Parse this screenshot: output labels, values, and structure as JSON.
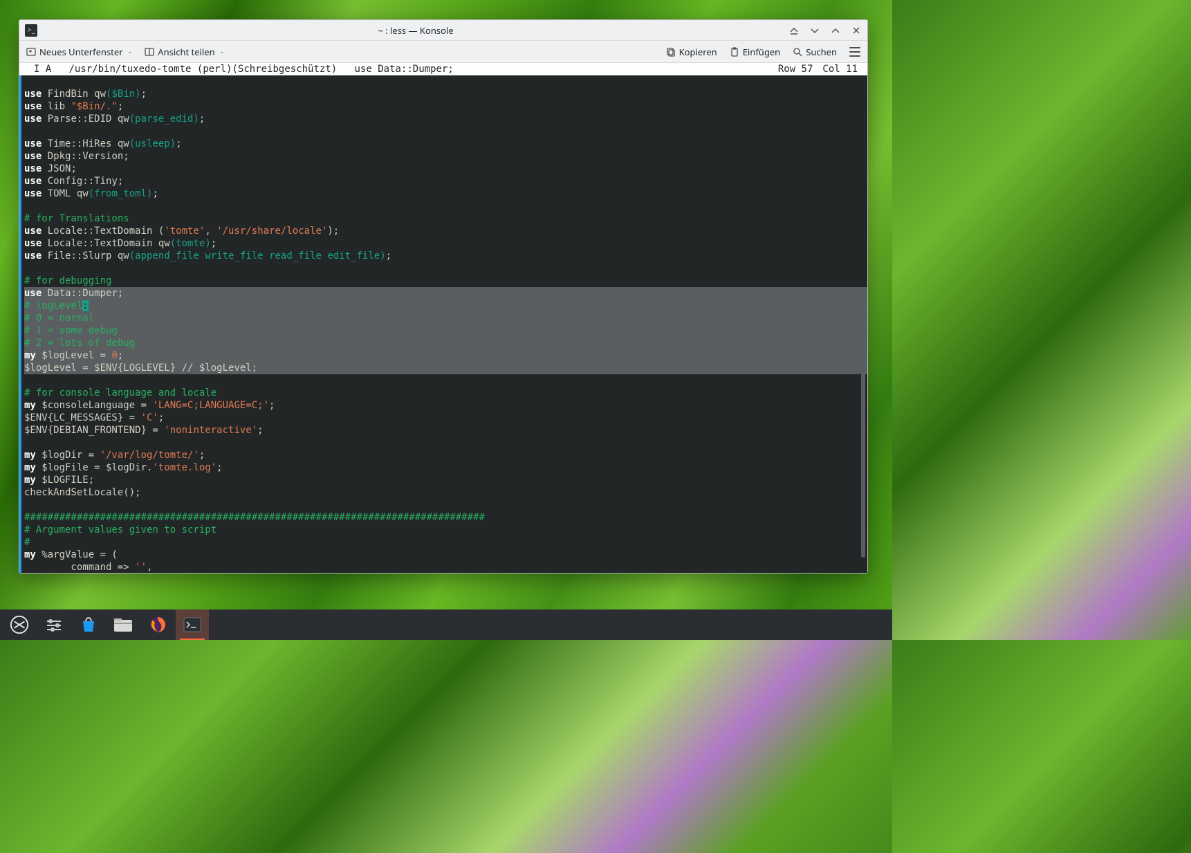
{
  "window": {
    "title": "~ : less — Konsole"
  },
  "toolbar": {
    "new_subwindow": "Neues Unterfenster",
    "split_view": "Ansicht teilen",
    "copy": "Kopieren",
    "paste": "Einfügen",
    "search": "Suchen"
  },
  "status": {
    "mode": "  I A",
    "path": "/usr/bin/tuxedo-tomte",
    "lang": "(perl)",
    "readonly": "(Schreibgeschützt)",
    "decl": "use Data::Dumper;",
    "row_label": "Row",
    "row_val": "57",
    "col_label": "Col",
    "col_val": "11"
  },
  "code": {
    "l01_a": "use",
    "l01_b": " FindBin qw",
    "l01_c": "(",
    "l01_d": "$Bin",
    "l01_e": ")",
    "l01_f": ";",
    "l02_a": "use",
    "l02_b": " lib ",
    "l02_c": "\"$Bin/.\"",
    "l02_d": ";",
    "l03_a": "use",
    "l03_b": " Parse::EDID qw",
    "l03_c": "(",
    "l03_d": "parse_edid",
    "l03_e": ")",
    "l03_f": ";",
    "l05_a": "use",
    "l05_b": " Time::HiRes qw",
    "l05_c": "(",
    "l05_d": "usleep",
    "l05_e": ")",
    "l05_f": ";",
    "l06_a": "use",
    "l06_b": " Dpkg::Version;",
    "l07_a": "use",
    "l07_b": " JSON;",
    "l08_a": "use",
    "l08_b": " Config::Tiny;",
    "l09_a": "use",
    "l09_b": " TOML qw",
    "l09_c": "(",
    "l09_d": "from_toml",
    "l09_e": ")",
    "l09_f": ";",
    "l11": "# for Translations",
    "l12_a": "use",
    "l12_b": " Locale::TextDomain (",
    "l12_c": "'tomte'",
    "l12_d": ", ",
    "l12_e": "'/usr/share/locale'",
    "l12_f": ");",
    "l13_a": "use",
    "l13_b": " Locale::TextDomain qw",
    "l13_c": "(",
    "l13_d": "tomte",
    "l13_e": ")",
    "l13_f": ";",
    "l14_a": "use",
    "l14_b": " File::Slurp qw",
    "l14_c": "(",
    "l14_d": "append_file write_file read_file edit_file",
    "l14_e": ")",
    "l14_f": ";",
    "l16": "# for debugging",
    "l17_a": "use",
    "l17_b": " Data::Dumper;",
    "l18_a": "# logLevel",
    "l18_b": ":",
    "l19": "# 0 = normal",
    "l20": "# 1 = some debug",
    "l21": "# 2 = lots of debug",
    "l22_a": "my",
    "l22_b": " $logLevel = ",
    "l22_c": "0",
    "l22_d": ";",
    "l23": "$logLevel = $ENV{LOGLEVEL} // $logLevel;",
    "l25": "# for console language and locale",
    "l26_a": "my",
    "l26_b": " $consoleLanguage = ",
    "l26_c": "'LANG=C;LANGUAGE=C;'",
    "l26_d": ";",
    "l27_a": "$ENV{LC_MESSAGES} = ",
    "l27_b": "'C'",
    "l27_c": ";",
    "l28_a": "$ENV{DEBIAN_FRONTEND} = ",
    "l28_b": "'noninteractive'",
    "l28_c": ";",
    "l30_a": "my",
    "l30_b": " $logDir = ",
    "l30_c": "'/var/log/tomte/'",
    "l30_d": ";",
    "l31_a": "my",
    "l31_b": " $logFile = $logDir.",
    "l31_c": "'tomte.log'",
    "l31_d": ";",
    "l32_a": "my",
    "l32_b": " $LOGFILE;",
    "l33": "checkAndSetLocale();",
    "l35": "###############################################################################",
    "l36": "# Argument values given to script",
    "l37": "#",
    "l38_a": "my",
    "l38_b": " %argValue = (",
    "l39_a": "        command => ",
    "l39_b": "''",
    "l39_c": ","
  },
  "taskbar": {
    "start": "start-menu",
    "settings": "settings",
    "discover": "software-center",
    "files": "file-manager",
    "firefox": "firefox",
    "konsole": "konsole"
  }
}
